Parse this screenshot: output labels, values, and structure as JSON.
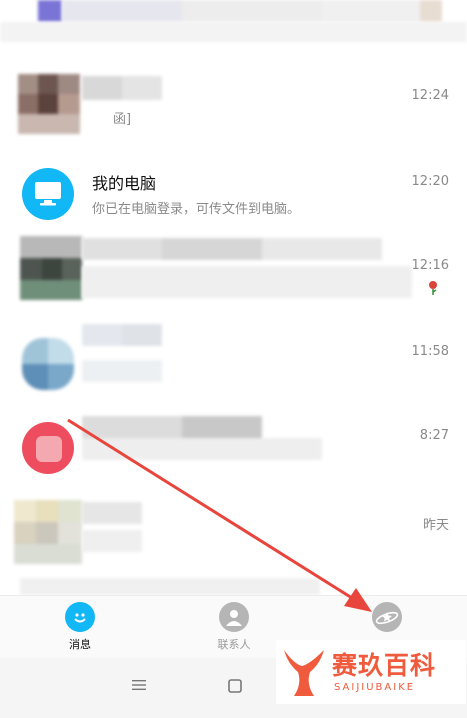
{
  "chats": [
    {
      "name": "",
      "preview": "",
      "time": ""
    },
    {
      "name": "",
      "preview": "函]",
      "time": "12:24"
    },
    {
      "name": "我的电脑",
      "preview": "你已在电脑登录，可传文件到电脑。",
      "time": "12:20"
    },
    {
      "name": "",
      "preview": "",
      "time": "12:16"
    },
    {
      "name": "",
      "preview": "",
      "time": "11:58"
    },
    {
      "name": "",
      "preview": "",
      "time": "8:27"
    },
    {
      "name": "",
      "preview": "",
      "time": "昨天"
    }
  ],
  "tabbar": {
    "messages": {
      "label": "消息",
      "icon": "chat-smile-icon",
      "color": "#12b7f5"
    },
    "contacts": {
      "label": "联系人",
      "icon": "person-icon",
      "color": "#9a9a9a"
    },
    "dynamic": {
      "label": "",
      "icon": "star-planet-icon",
      "color": "#9a9a9a"
    }
  },
  "watermark": {
    "title": "赛玖百科",
    "subtitle": "SAIJIUBAIKE",
    "icon": "whale-tail-logo"
  },
  "annotation": {
    "icon": "red-arrow",
    "color": "#e8453c"
  }
}
